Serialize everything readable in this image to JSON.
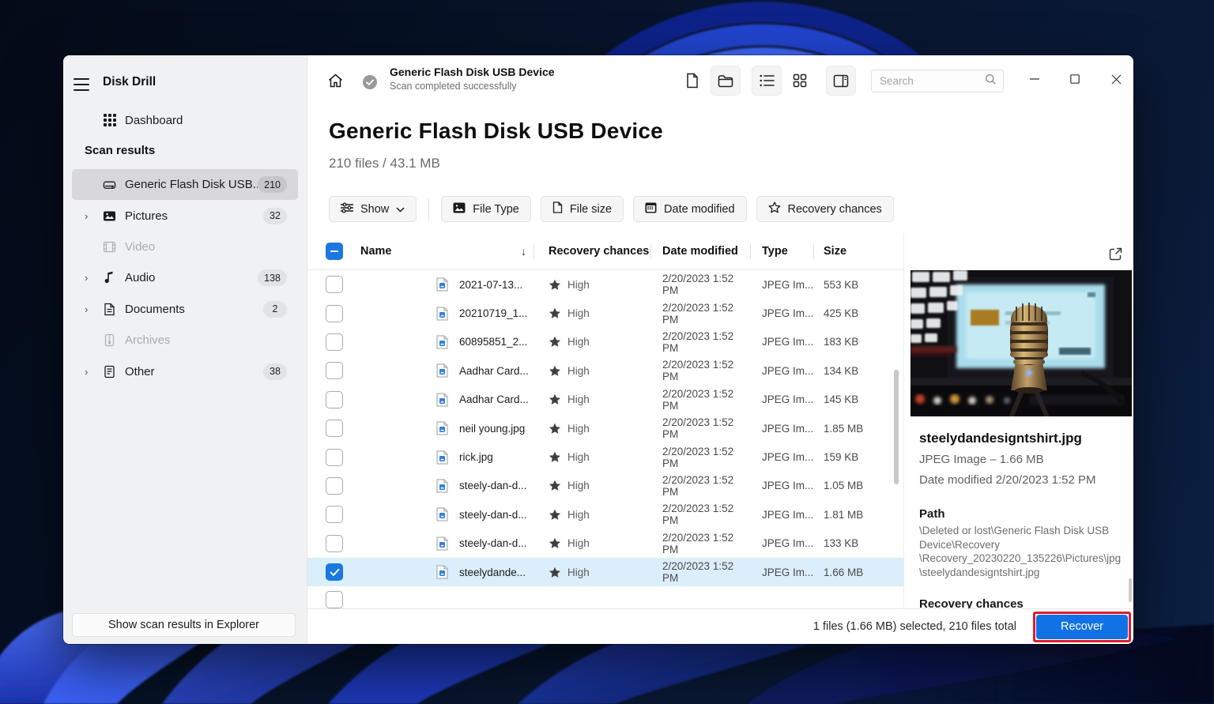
{
  "app": {
    "name": "Disk Drill"
  },
  "sidebar": {
    "title": "Disk Drill",
    "dashboard_label": "Dashboard",
    "section_label": "Scan results",
    "items": [
      {
        "label": "Generic Flash Disk USB...",
        "badge": "210"
      },
      {
        "label": "Pictures",
        "badge": "32"
      },
      {
        "label": "Video",
        "badge": ""
      },
      {
        "label": "Audio",
        "badge": "138"
      },
      {
        "label": "Documents",
        "badge": "2"
      },
      {
        "label": "Archives",
        "badge": ""
      },
      {
        "label": "Other",
        "badge": "38"
      }
    ],
    "footer_button": "Show scan results in Explorer"
  },
  "topbar": {
    "device_name": "Generic Flash Disk USB Device",
    "status": "Scan completed successfully",
    "search_placeholder": "Search"
  },
  "content": {
    "title": "Generic Flash Disk USB Device",
    "summary": "210 files / 43.1 MB",
    "filters": {
      "show": "Show",
      "file_type": "File Type",
      "file_size": "File size",
      "date_modified": "Date modified",
      "recovery_chances": "Recovery chances"
    }
  },
  "table": {
    "headers": {
      "name": "Name",
      "recovery": "Recovery chances",
      "date": "Date modified",
      "type": "Type",
      "size": "Size"
    },
    "rows": [
      {
        "name": "2021-07-13...",
        "recovery": "High",
        "date": "2/20/2023 1:52 PM",
        "type": "JPEG Im...",
        "size": "553 KB"
      },
      {
        "name": "20210719_1...",
        "recovery": "High",
        "date": "2/20/2023 1:52 PM",
        "type": "JPEG Im...",
        "size": "425 KB"
      },
      {
        "name": "60895851_2...",
        "recovery": "High",
        "date": "2/20/2023 1:52 PM",
        "type": "JPEG Im...",
        "size": "183 KB"
      },
      {
        "name": "Aadhar Card...",
        "recovery": "High",
        "date": "2/20/2023 1:52 PM",
        "type": "JPEG Im...",
        "size": "134 KB"
      },
      {
        "name": "Aadhar Card...",
        "recovery": "High",
        "date": "2/20/2023 1:52 PM",
        "type": "JPEG Im...",
        "size": "145 KB"
      },
      {
        "name": "neil young.jpg",
        "recovery": "High",
        "date": "2/20/2023 1:52 PM",
        "type": "JPEG Im...",
        "size": "1.85 MB"
      },
      {
        "name": "rick.jpg",
        "recovery": "High",
        "date": "2/20/2023 1:52 PM",
        "type": "JPEG Im...",
        "size": "159 KB"
      },
      {
        "name": "steely-dan-d...",
        "recovery": "High",
        "date": "2/20/2023 1:52 PM",
        "type": "JPEG Im...",
        "size": "1.05 MB"
      },
      {
        "name": "steely-dan-d...",
        "recovery": "High",
        "date": "2/20/2023 1:52 PM",
        "type": "JPEG Im...",
        "size": "1.81 MB"
      },
      {
        "name": "steely-dan-d...",
        "recovery": "High",
        "date": "2/20/2023 1:52 PM",
        "type": "JPEG Im...",
        "size": "133 KB"
      },
      {
        "name": "steelydande...",
        "recovery": "High",
        "date": "2/20/2023 1:52 PM",
        "type": "JPEG Im...",
        "size": "1.66 MB"
      }
    ]
  },
  "preview": {
    "filename": "steelydandesigntshirt.jpg",
    "meta": "JPEG Image – 1.66 MB",
    "date_modified": "Date modified 2/20/2023 1:52 PM",
    "path_label": "Path",
    "path_lines": [
      "\\Deleted or lost\\Generic Flash Disk USB",
      "Device\\Recovery",
      "\\Recovery_20230220_135226\\Pictures\\jpg",
      "\\steelydandesigntshirt.jpg"
    ],
    "clipped_heading": "Recovery chances"
  },
  "statusbar": {
    "selection": "1 files (1.66 MB) selected, 210 files total",
    "recover": "Recover"
  },
  "colors": {
    "accent": "#1371e6",
    "selected_row": "#dbeefb",
    "annotation": "#de1c2c"
  }
}
